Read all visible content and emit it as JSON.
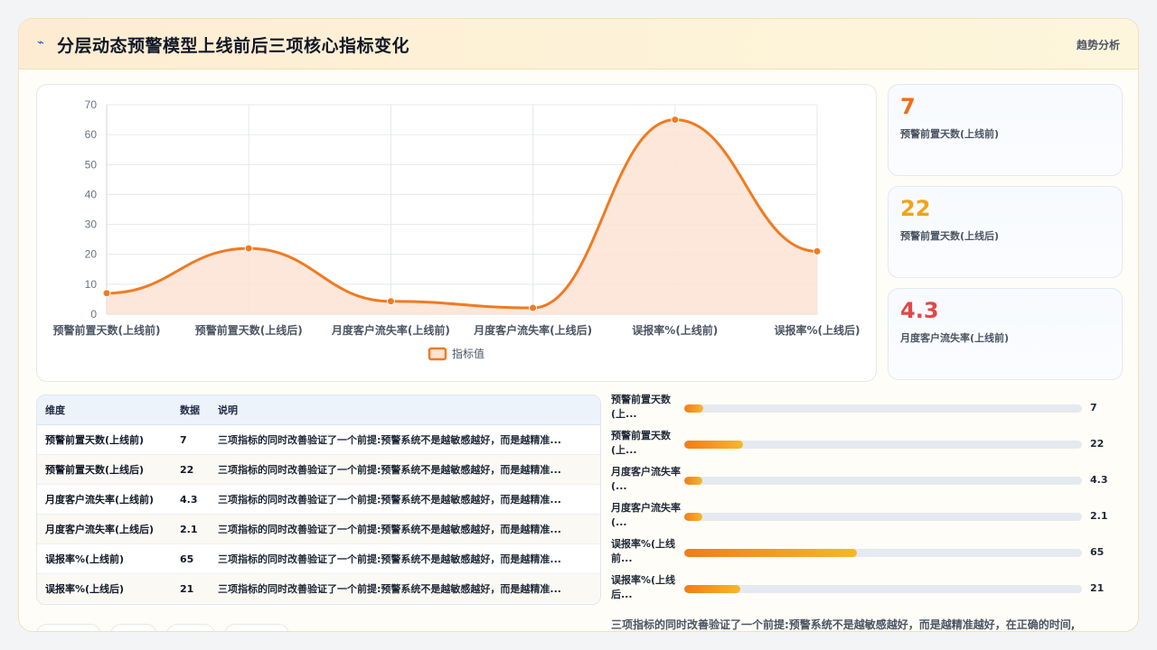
{
  "header": {
    "title": "分层动态预警模型上线前后三项核心指标变化",
    "tag": "趋势分析",
    "icon": "trend-line-icon"
  },
  "chart_data": {
    "type": "area",
    "categories": [
      "预警前置天数(上线前)",
      "预警前置天数(上线后)",
      "月度客户流失率(上线前)",
      "月度客户流失率(上线后)",
      "误报率%(上线前)",
      "误报率%(上线后)"
    ],
    "series": [
      {
        "name": "指标值",
        "values": [
          7,
          22,
          4.3,
          2.1,
          65,
          21
        ]
      }
    ],
    "ylim": [
      0,
      70
    ],
    "yticks": [
      0,
      10,
      20,
      30,
      40,
      50,
      60,
      70
    ],
    "grid": true,
    "legend": "bottom-center",
    "line_color": "#ef7b22",
    "fill_color": "#fde3d3"
  },
  "stats": [
    {
      "value": "7",
      "label": "预警前置天数(上线前)",
      "color": "#ef6c1a"
    },
    {
      "value": "22",
      "label": "预警前置天数(上线后)",
      "color": "#f0a417"
    },
    {
      "value": "4.3",
      "label": "月度客户流失率(上线前)",
      "color": "#e04848"
    }
  ],
  "table": {
    "headers": [
      "维度",
      "数据",
      "说明"
    ],
    "rows": [
      [
        "预警前置天数(上线前)",
        "7",
        "三项指标的同时改善验证了一个前提:预警系统不是越敏感越好，而是越精准..."
      ],
      [
        "预警前置天数(上线后)",
        "22",
        "三项指标的同时改善验证了一个前提:预警系统不是越敏感越好，而是越精准..."
      ],
      [
        "月度客户流失率(上线前)",
        "4.3",
        "三项指标的同时改善验证了一个前提:预警系统不是越敏感越好，而是越精准..."
      ],
      [
        "月度客户流失率(上线后)",
        "2.1",
        "三项指标的同时改善验证了一个前提:预警系统不是越敏感越好，而是越精准..."
      ],
      [
        "误报率%(上线前)",
        "65",
        "三项指标的同时改善验证了一个前提:预警系统不是越敏感越好，而是越精准..."
      ],
      [
        "误报率%(上线后)",
        "21",
        "三项指标的同时改善验证了一个前提:预警系统不是越敏感越好，而是越精准..."
      ]
    ]
  },
  "bars": {
    "max": 150,
    "items": [
      {
        "label": "预警前置天数(上...",
        "value": 7,
        "text": "7"
      },
      {
        "label": "预警前置天数(上...",
        "value": 22,
        "text": "22"
      },
      {
        "label": "月度客户流失率(...",
        "value": 4.3,
        "text": "4.3"
      },
      {
        "label": "月度客户流失率(...",
        "value": 2.1,
        "text": "2.1"
      },
      {
        "label": "误报率%(上线前...",
        "value": 65,
        "text": "65"
      },
      {
        "label": "误报率%(上线后...",
        "value": 21,
        "text": "21"
      }
    ]
  },
  "footnote": "三项指标的同时改善验证了一个前提:预警系统不是越敏感越好，而是越精准越好，在正确的时间,"
}
